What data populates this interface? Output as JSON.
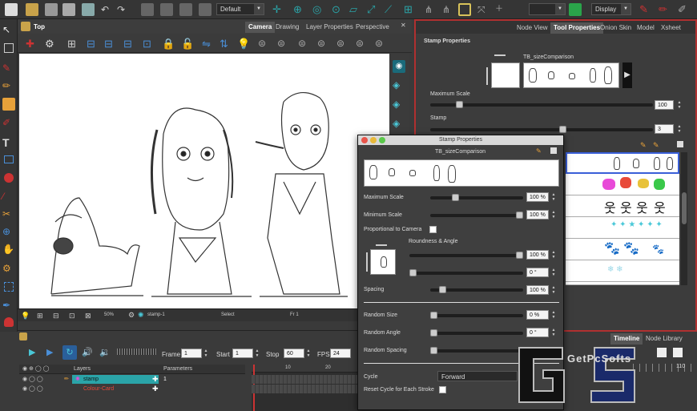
{
  "toolbar": {
    "mode_select": "Default",
    "display_select": "Display"
  },
  "view": {
    "title": "Top",
    "tabs": [
      {
        "label": "Camera",
        "active": true
      },
      {
        "label": "Drawing",
        "active": false
      },
      {
        "label": "Layer Properties",
        "active": false
      },
      {
        "label": "Perspective",
        "active": false
      }
    ],
    "status": {
      "zoom": "50%",
      "node": "stamp-1",
      "tool": "Select",
      "frame": "Fr 1"
    }
  },
  "right_panel": {
    "tabs": [
      {
        "label": "Node View",
        "active": false
      },
      {
        "label": "Tool Properties",
        "active": true
      },
      {
        "label": "Onion Skin",
        "active": false
      },
      {
        "label": "Model",
        "active": false
      },
      {
        "label": "Xsheet",
        "active": false
      }
    ],
    "section_title": "Stamp Properties",
    "preset_name": "TB_sizeComparison",
    "max_scale_label": "Maximum Scale",
    "max_scale_value": "100",
    "max_scale_level": 0.12,
    "stamp_label": "Stamp",
    "stamp_value": "3",
    "stamp_level": 0.6
  },
  "dialog": {
    "title": "Stamp Properties",
    "preset_name": "TB_sizeComparison",
    "max_scale_label": "Maximum Scale",
    "max_scale_value": "100 %",
    "max_scale_level": 0.25,
    "min_scale_label": "Minimum Scale",
    "min_scale_value": "100 %",
    "min_scale_level": 1.0,
    "proportional_label": "Proportional to Camera",
    "roundness_angle_label": "Roundness & Angle",
    "roundness_value": "100 %",
    "roundness_level": 1.0,
    "angle_value": "0 °",
    "angle_level": 0.0,
    "spacing_label": "Spacing",
    "spacing_value": "100 %",
    "spacing_level": 0.1,
    "random_size_label": "Random Size",
    "random_size_value": "0 %",
    "random_angle_label": "Random Angle",
    "random_angle_value": "0 °",
    "random_spacing_label": "Random Spacing",
    "cycle_label": "Cycle",
    "cycle_value": "Forward",
    "reset_cycle_label": "Reset Cycle for Each Stroke"
  },
  "timeline": {
    "frame_label": "Frame",
    "frame_value": "1",
    "start_label": "Start",
    "start_value": "1",
    "stop_label": "Stop",
    "stop_value": "60",
    "fps_label": "FPS",
    "fps_value": "24",
    "layers_header": "Layers",
    "params_header": "Parameters",
    "layers": [
      {
        "name": "stamp",
        "selected": true,
        "value": "1"
      },
      {
        "name": "Colour-Card",
        "selected": false,
        "value": ""
      }
    ],
    "ruler": [
      "10",
      "20"
    ],
    "right_tabs": [
      {
        "label": "Timeline",
        "active": true
      },
      {
        "label": "Node Library",
        "active": false
      }
    ],
    "right_ruler": "110"
  },
  "watermark": {
    "text": "GetPcSofts"
  },
  "colors": {
    "accent_red": "#b03030",
    "layer_teal": "#2aa4a8",
    "panel_bg": "#3c3c3c"
  }
}
